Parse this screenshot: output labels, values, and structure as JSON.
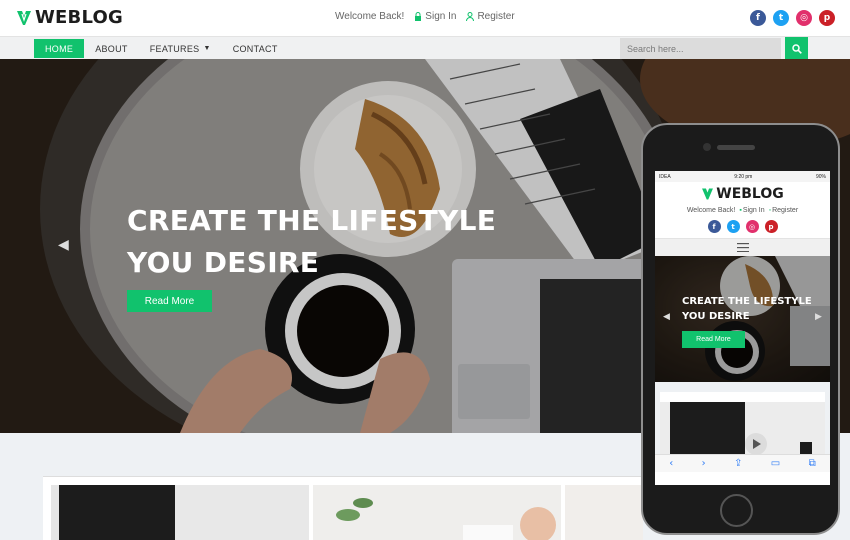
{
  "brand": {
    "name": "WEBLOG",
    "accent_color": "#11c26d"
  },
  "header": {
    "welcome": "Welcome Back!",
    "sign_in": "Sign In",
    "register": "Register"
  },
  "socials": [
    {
      "icon": "facebook-icon",
      "glyph": "f",
      "color": "#3b5998"
    },
    {
      "icon": "twitter-icon",
      "glyph": "t",
      "color": "#1da1f2"
    },
    {
      "icon": "instagram-icon",
      "glyph": "◎",
      "color": "#e1306c"
    },
    {
      "icon": "pinterest-icon",
      "glyph": "p",
      "color": "#cb2027"
    }
  ],
  "nav": {
    "items": [
      "HOME",
      "ABOUT",
      "FEATURES",
      "CONTACT"
    ],
    "search_placeholder": "Search here..."
  },
  "hero": {
    "title_line1": "CREATE THE LIFESTYLE",
    "title_line2": "YOU DESIRE",
    "button": "Read More"
  },
  "phone": {
    "status_carrier": "IDEA",
    "status_time": "9:20 pm",
    "status_battery": "90%",
    "hero_line1": "CREATE THE LIFESTYLE",
    "hero_line2": "YOU DESIRE",
    "button": "Read More"
  }
}
